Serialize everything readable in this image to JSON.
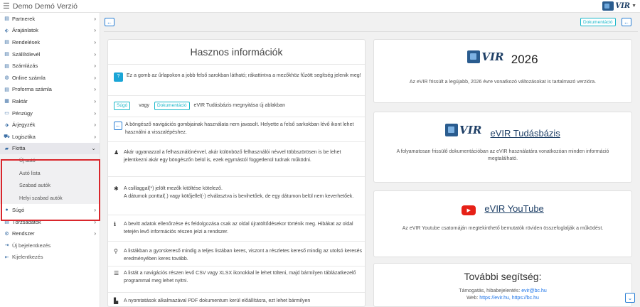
{
  "app": {
    "title": "Demo Demó Verzió",
    "logo_text": "VIR"
  },
  "header": {
    "doc_button": "Dokumentáció"
  },
  "sidebar": {
    "items": [
      {
        "icon": "document-icon",
        "label": "Partnerek"
      },
      {
        "icon": "tags-icon",
        "label": "Árajánlatok"
      },
      {
        "icon": "document-icon",
        "label": "Rendelések"
      },
      {
        "icon": "document-icon",
        "label": "Szállítólevél"
      },
      {
        "icon": "document-icon",
        "label": "Számlázás"
      },
      {
        "icon": "globe-icon",
        "label": "Online számla"
      },
      {
        "icon": "document-icon",
        "label": "Proforma számla"
      },
      {
        "icon": "warehouse-icon",
        "label": "Raktár"
      },
      {
        "icon": "money-icon",
        "label": "Pénzügy"
      },
      {
        "icon": "tag-icon",
        "label": "Árjegyzék"
      },
      {
        "icon": "truck-icon",
        "label": "Logisztika"
      }
    ],
    "flotta": {
      "label": "Flotta",
      "subitems": [
        "Új autó",
        "Autó lista",
        "Szabad autók",
        "Helyi szabad autók"
      ]
    },
    "items2": [
      {
        "icon": "help-icon",
        "label": "Súgó"
      },
      {
        "icon": "database-icon",
        "label": "Törzsadatok"
      },
      {
        "icon": "gears-icon",
        "label": "Rendszer"
      }
    ],
    "plain": [
      "Új bejelentkezés",
      "Kijelentkezés"
    ]
  },
  "info": {
    "title": "Hasznos információk",
    "help_text": "Ez a gomb az űrlapokon a jobb felső sarokban látható; rákattintva a mezőkhöz fűzött segítség jelenik meg!",
    "sugo": "Súgó",
    "vagy": "vagy",
    "dok": "Dokumentáció",
    "kb_text": "eVIR Tudásbázis megnyitása új ablakban",
    "nav_text": "A böngésző navigációs gombjainak használata nem javasolt. Helyette a felső sarkokban lévő ikont lehet használni a visszalépéshez.",
    "user_text": "Akár ugyanazzal a felhasználónévvel, akár különböző felhasználói névvel többszörösen is be lehet jelentkezni akár egy böngészőn belül is, ezek egymástól függetlenül tudnak működni.",
    "req_text_1": "A csillaggal(*) jelölt mezők kitöltése kötelező.",
    "req_text_2": "A dátumok ponttal(.) vagy kötőjellel(-) elválasztva is bevihetőek, de egy dátumon belül nem keverhetőek.",
    "data_text": "A bevitt adatok ellenőrzése és feldolgozása csak az oldal újratöltődésekor történik meg. Hibákat az oldal tetején levő információs részen jelzi a rendszer.",
    "search_text": "A listákban a gyorskereső mindig a teljes listában keres, viszont a részletes kereső mindig az utolsó keresés eredményében keres tovább.",
    "csv_text": "A listát a navigációs részen levő CSV vagy XLSX ikonokkal le lehet tölteni, majd bármilyen táblázatkezelő programmal meg lehet nyitni.",
    "pdf_text": "A nyomtatások alkalmazával PDF dokumentum kerül előállításra, ezt lehet bármilyen"
  },
  "cards": {
    "year_title": "2026",
    "year_desc": "Az eVIR frissült a legújabb, 2026 évre vonatkozó változásokat is tartalmazó verzióra.",
    "kb_title": "eVIR Tudásbázis",
    "kb_desc": "A folyamatosan frissülő dokumentációban az eVIR használatára vonatkozóan minden információ megtalálható.",
    "yt_title": "eVIR YouTube",
    "yt_desc": "Az eVIR Youtube csatornáján megtekinthető bemutatók röviden összefoglalják a működést.",
    "more_title": "További segítség:",
    "support_label": "Támogatás, hibabejelentés:",
    "support_email": "evir@bc.hu",
    "web_label": "Web:",
    "web_links": "https://evir.hu, https://bc.hu"
  }
}
